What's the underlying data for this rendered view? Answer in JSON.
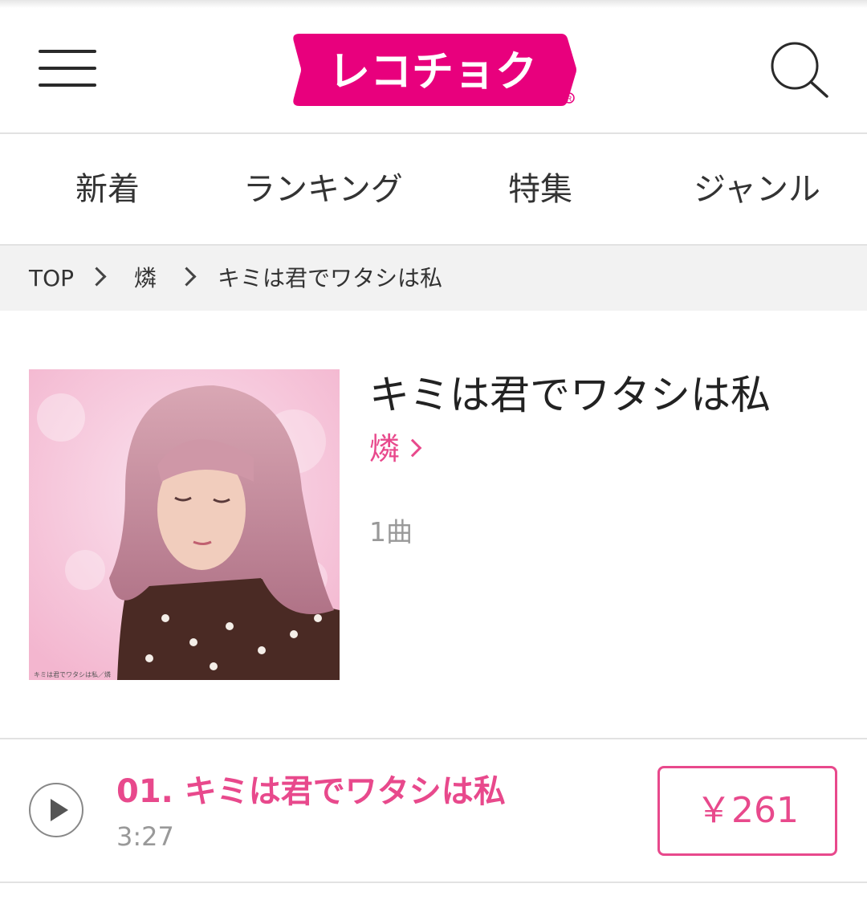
{
  "header": {
    "logo_text": "レコチョク",
    "brand_color": "#e8007d",
    "menu_icon": "hamburger-icon",
    "search_icon": "search-icon"
  },
  "nav": {
    "items": [
      "新着",
      "ランキング",
      "特集",
      "ジャンル"
    ]
  },
  "breadcrumb": {
    "items": [
      "TOP",
      "燐",
      "キミは君でワタシは私"
    ]
  },
  "album": {
    "title": "キミは君でワタシは私",
    "artist": "燐",
    "track_count": "1曲",
    "cover_caption": "キミは君でワタシは私／燐"
  },
  "tracks": [
    {
      "title": "01. キミは君でワタシは私",
      "duration": "3:27",
      "price": "￥261"
    }
  ],
  "colors": {
    "accent": "#e8498c",
    "breadcrumb_bg": "#f2f2f2"
  }
}
